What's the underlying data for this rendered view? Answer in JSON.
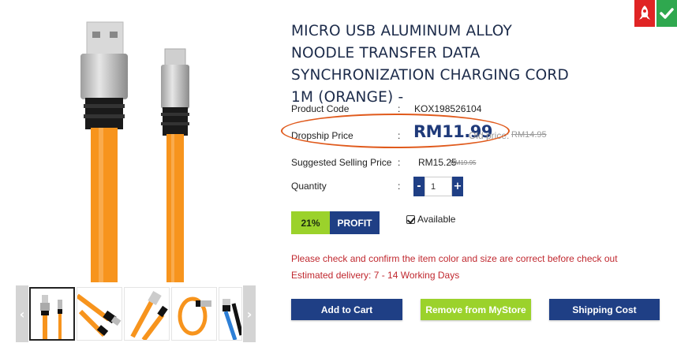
{
  "product": {
    "title": "MICRO USB ALUMINUM ALLOY NOODLE TRANSFER DATA SYNCHRONIZATION CHARGING CORD 1M (ORANGE) -",
    "code_label": "Product Code",
    "code_value": "KOX198526104",
    "colon": ":",
    "dropship_label": "Dropship Price",
    "dropship_price": "RM11.99",
    "old_price_label": "Old price:",
    "old_price": "RM14.95",
    "ssp_label": "Suggested Selling Price",
    "ssp_value": "RM15.25",
    "ssp_old": "RM19.95",
    "quantity_label": "Quantity",
    "quantity_value": "1",
    "minus": "-",
    "plus": "+",
    "profit_percent": "21%",
    "profit_label": "PROFIT",
    "availability": "Available"
  },
  "notices": {
    "confirm": "Please check and confirm the item color and size are correct before check out",
    "delivery": "Estimated delivery: 7 - 14 Working Days"
  },
  "actions": {
    "add_to_cart": "Add to Cart",
    "remove_from_mystore": "Remove from MyStore",
    "shipping_cost": "Shipping Cost"
  },
  "gallery": {
    "prev_arrow": "‹",
    "next_arrow": "›"
  },
  "colors": {
    "navy": "#1f3f85",
    "lime": "#9bd22b",
    "orange_cable": "#f7941d",
    "warning_red": "#c0282f",
    "highlight_orange": "#e05a1c"
  },
  "icons": {
    "red_badge": "rocket-icon",
    "green_badge": "checkmark-icon"
  }
}
